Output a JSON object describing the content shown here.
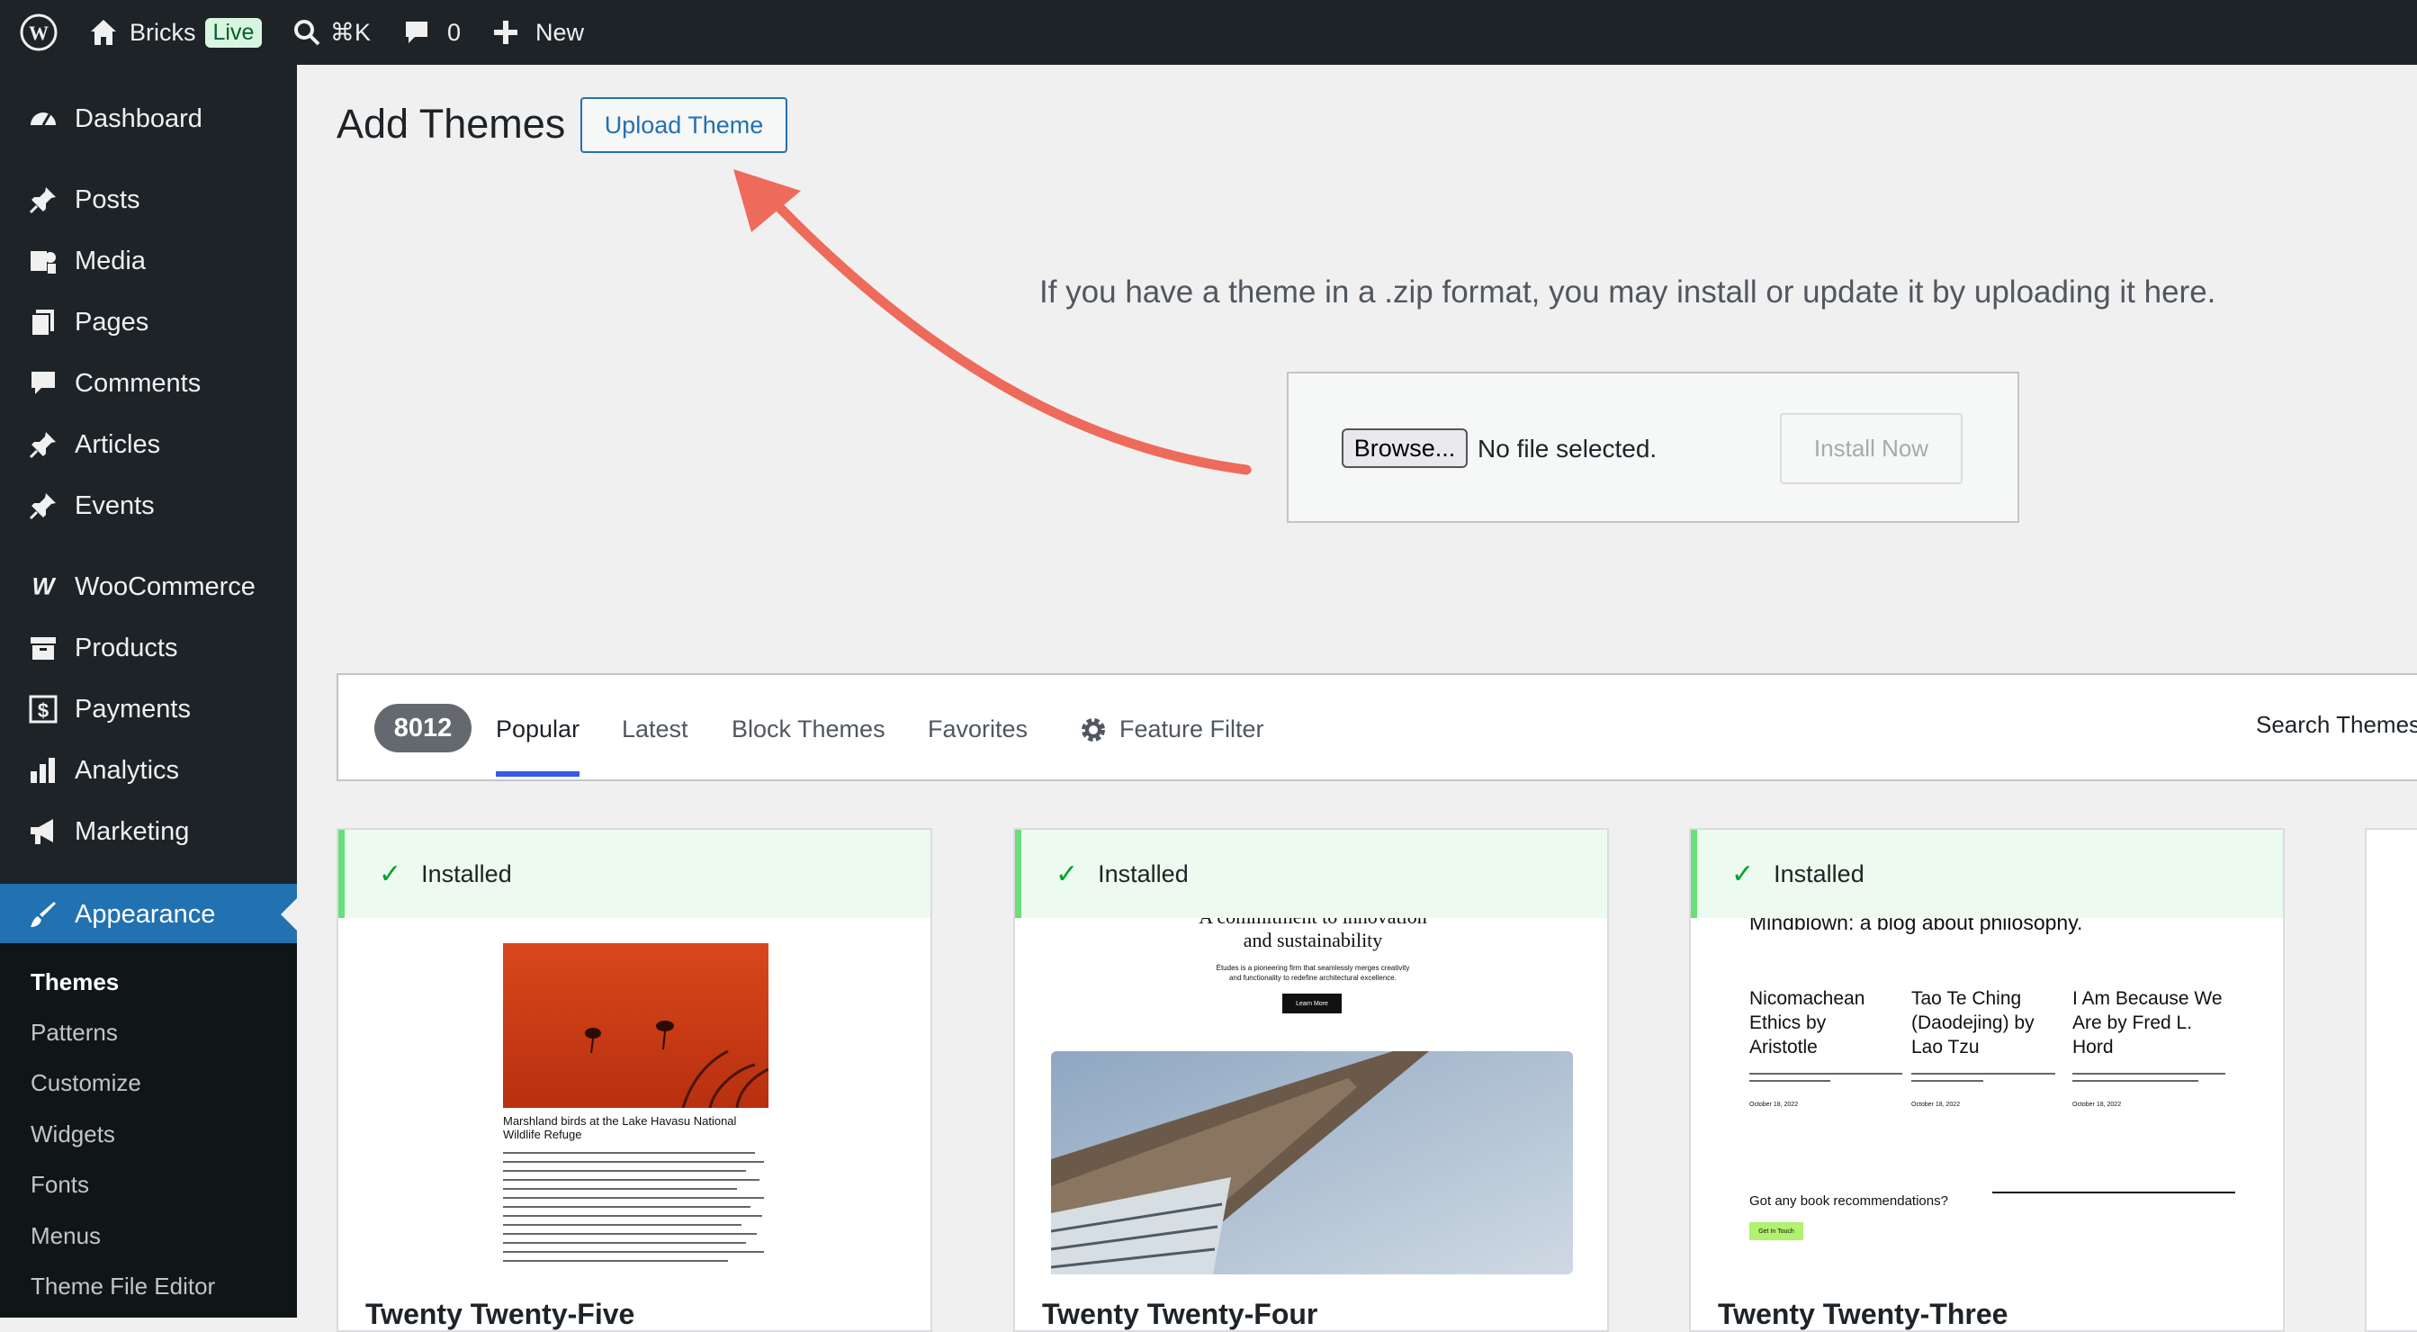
{
  "admin_bar": {
    "site_name": "Bricks",
    "live_badge": "Live",
    "search_shortcut": "⌘K",
    "comment_count": "0",
    "new_label": "New"
  },
  "sidebar": {
    "items": [
      {
        "label": "Dashboard",
        "icon": "dashboard-icon"
      },
      {
        "label": "Posts",
        "icon": "pin-icon"
      },
      {
        "label": "Media",
        "icon": "media-icon"
      },
      {
        "label": "Pages",
        "icon": "pages-icon"
      },
      {
        "label": "Comments",
        "icon": "comment-icon"
      },
      {
        "label": "Articles",
        "icon": "pin-icon"
      },
      {
        "label": "Events",
        "icon": "pin-icon"
      },
      {
        "label": "WooCommerce",
        "icon": "woo-icon"
      },
      {
        "label": "Products",
        "icon": "archive-icon"
      },
      {
        "label": "Payments",
        "icon": "dollar-icon"
      },
      {
        "label": "Analytics",
        "icon": "bar-chart-icon"
      },
      {
        "label": "Marketing",
        "icon": "megaphone-icon"
      },
      {
        "label": "Appearance",
        "icon": "paintbrush-icon"
      }
    ],
    "submenu": [
      "Themes",
      "Patterns",
      "Customize",
      "Widgets",
      "Fonts",
      "Menus",
      "Theme File Editor"
    ]
  },
  "main": {
    "title": "Add Themes",
    "upload_button": "Upload Theme",
    "upload_description": "If you have a theme in a .zip format, you may install or update it by uploading it here.",
    "browse_button": "Browse...",
    "no_file": "No file selected.",
    "install_button": "Install Now"
  },
  "filter": {
    "count": "8012",
    "tabs": [
      "Popular",
      "Latest",
      "Block Themes",
      "Favorites"
    ],
    "feature_filter": "Feature Filter",
    "search_label": "Search Themes"
  },
  "cards": [
    {
      "notice": "Installed",
      "name": "Twenty Twenty-Five",
      "preview_caption": "Marshland birds at the Lake Havasu National Wildlife Refuge"
    },
    {
      "notice": "Installed",
      "name": "Twenty Twenty-Four",
      "preview_heading_1": "A commitment to innovation",
      "preview_heading_2": "and sustainability",
      "preview_body": "Études is a pioneering firm that seamlessly merges creativity and functionality to redefine architectural excellence.",
      "preview_button": "Learn More"
    },
    {
      "notice": "Installed",
      "name": "Twenty Twenty-Three",
      "preview_title": "Mindblown: a blog about philosophy.",
      "preview_posts": [
        {
          "title": "Nicomachean Ethics by Aristotle",
          "date": "October 18, 2022"
        },
        {
          "title": "Tao Te Ching (Daodejing) by Lao Tzu",
          "date": "October 18, 2022"
        },
        {
          "title": "I Am Because We Are by Fred L. Hord",
          "date": "October 18, 2022"
        }
      ],
      "preview_footer": "Got any book recommendations?",
      "preview_button": "Get In Touch"
    }
  ],
  "colors": {
    "admin_bg": "#1d2327",
    "accent": "#2271b1",
    "arrow": "#ee6a5a",
    "installed_green": "#68de7c"
  }
}
